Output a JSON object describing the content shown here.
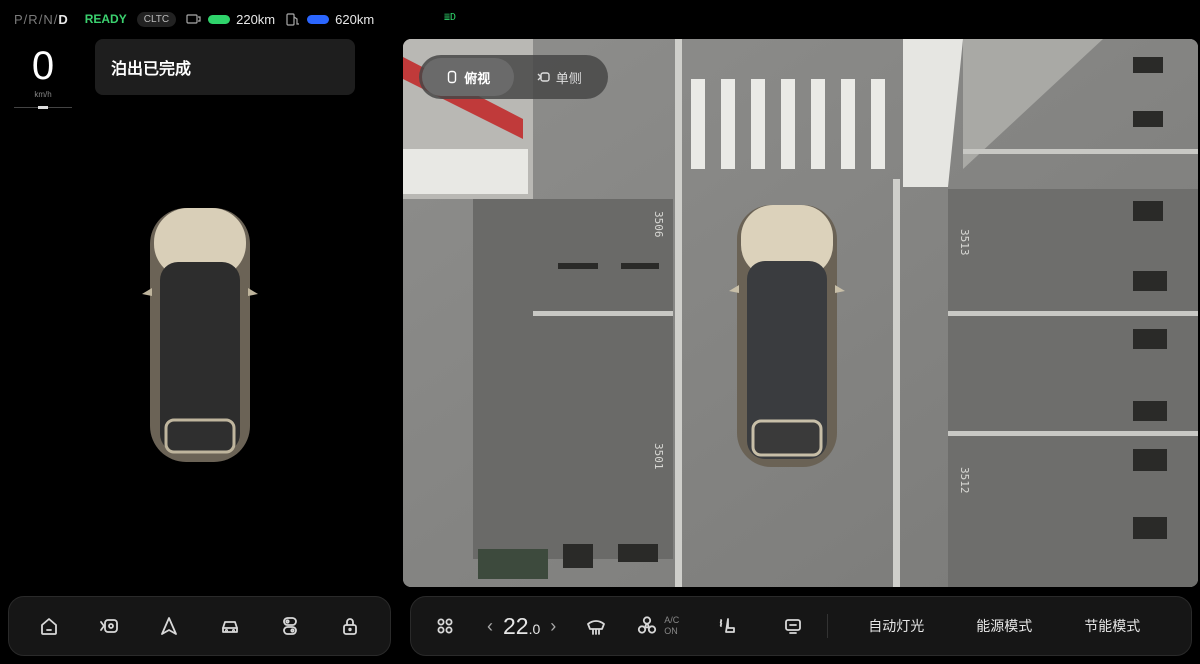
{
  "status": {
    "gears": [
      "P",
      "R",
      "N",
      "D"
    ],
    "gear_sep": "/",
    "active_gear": "D",
    "ready": "READY",
    "cycle": "CLTC",
    "electric_range": "220km",
    "fuel_range": "620km",
    "colors": {
      "ready": "#3bd16f",
      "electric_bar": "#2fd36b",
      "fuel_bar": "#2b66ff"
    }
  },
  "speed": {
    "value": "0",
    "unit": "km/h"
  },
  "notice": {
    "text": "泊出已完成"
  },
  "camera": {
    "views": [
      {
        "label": "俯视",
        "icon": "car-top-icon",
        "active": true
      },
      {
        "label": "单侧",
        "icon": "side-camera-icon",
        "active": false
      }
    ],
    "slot_numbers": [
      "3506",
      "3501",
      "3513",
      "3512"
    ]
  },
  "dock_left": {
    "icons": [
      "home-icon",
      "camera-icon",
      "navigation-icon",
      "car-icon",
      "settings-toggle-icon",
      "lock-icon"
    ]
  },
  "dock_right": {
    "apps_icon": "apps-grid-icon",
    "temperature": {
      "whole": "22",
      "decimal": ".0"
    },
    "ac": {
      "top": "A/C",
      "bottom": "ON"
    },
    "buttons": [
      "自动灯光",
      "能源模式",
      "节能模式"
    ]
  }
}
